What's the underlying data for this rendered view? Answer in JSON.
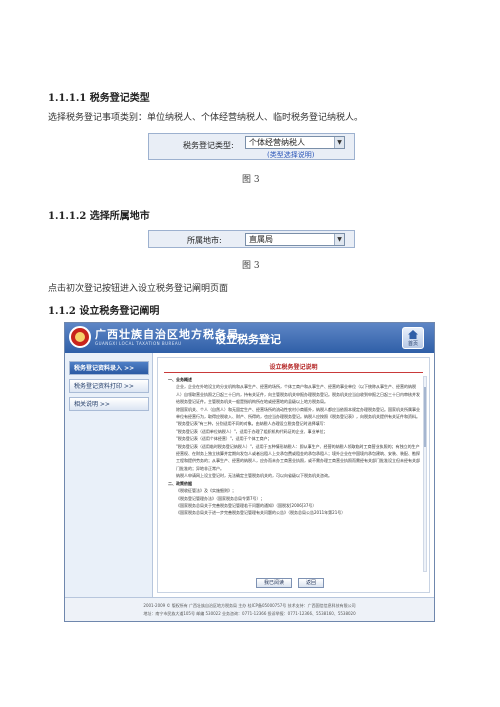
{
  "section_a": {
    "heading": "1.1.1.1 税务登记类型",
    "text": "选择税务登记事项类别：单位纳税人、个体经营纳税人、临时税务登记纳税人。",
    "form": {
      "label": "税务登记类型:",
      "value": "个体经营纳税人",
      "link": "(类型选择说明)"
    },
    "caption": "图 3"
  },
  "section_b": {
    "heading": "1.1.1.2 选择所属地市",
    "form": {
      "label": "所属地市:",
      "value": "直属局"
    },
    "caption": "图 3"
  },
  "instruction": "点击初次登记按钮进入设立税务登记阐明页面",
  "section_c": {
    "heading": "1.1.2 设立税务登记阐明"
  },
  "app": {
    "brand": "广西壮族自治区地方税务局",
    "brand_en": "GUANGXI LOCAL TAXATION BUREAU",
    "title": "设立税务登记",
    "home_label": "首页",
    "sidebar": [
      {
        "label": "税务登记资料录入 >>",
        "active": true
      },
      {
        "label": "税务登记资料打印 >>",
        "active": false
      },
      {
        "label": "相关说明 >>",
        "active": false
      }
    ],
    "doc": {
      "title": "设立税务登记说明",
      "lines": [
        {
          "t": "一、业务概述",
          "sec": true
        },
        {
          "t": "企业，企业在外地设立的分支机构和从事生产、经营的场所，个体工商户和从事生产、经营的事业单位（以下统称从事生产、经营的纳税人）自领取营业执照之日起三十日内，持有关证件，向主管税务机关申报办理税务登记。税务机关应当自收到申报之日起三十日内审核并发给税务登记证件。主管税务机关一般是指机构所在地或经营地的县级以上地方税务局。",
          "ind": true
        },
        {
          "t": "除国家机关、个人（自然人）和无固定生产、经营场所的流动性农村小商贩外，纳税人都应当依照本规定办理税务登记。国家机关所属事业单位有经营行为，取得应税收入、财产、所得的，也应当办理税务登记。纳税人应按照《税务登记表》，向税务机关提供有关证件和资料。",
          "ind": true
        },
        {
          "t": "\"税务登记表\"有三种，分别适用不同的对象。由纳税人办理设立税务登记时选择填写：",
          "ind": true
        },
        {
          "t": "\"税务登记表（适用单位纳税人）\"，适用于办理了组织机构代码证的企业、事业单位；",
          "ind": true
        },
        {
          "t": "\"税务登记表（适用个体经营）\"，适用于个体工商户；",
          "ind": true
        },
        {
          "t": "\"税务登记表（适用临时税务登记纳税人）\"，适用于五种情形纳税人：即从事生产、经营的纳税人领取临时工商营业执照的；有独立的生产经营权、在财务上独立核算并定期向发包人或者出租人上交承包费或租金的承包承租人；境外企业在中国境内承包建筑、安装、装配、勘探工程和提供劳务的；从事生产、经营的纳税人，应办而未办工商营业执照，或不需办理工商营业执照而需经有关部门批准设立但未经有关部门批准的；异地非正常户。",
          "ind": true
        },
        {
          "t": "纳税人申请网上设立登记时，无法确定主管税务机关的，可以向省级以下税务机关咨询。",
          "ind": true
        },
        {
          "t": "二、政策依据",
          "sec": true
        },
        {
          "t": "《税收征管法》及《实施细则》；",
          "ind": true
        },
        {
          "t": "《税务登记管理办法》（国家税务总局令第7号）；",
          "ind": true
        },
        {
          "t": "《国家税务总局关于完善税务登记管理若干问题的通知》（国税发[2006]37号）",
          "ind": true
        },
        {
          "t": "《国家税务总局关于进一步完善税务登记管理有关问题的公告》（税务总局公告2011年第21号）",
          "ind": true
        }
      ],
      "btn_next": "我已阅读",
      "btn_back": "返回"
    },
    "footer": [
      "2001-2009 © 版权所有 广西壮族自治区地方税务局 主办 桂ICP备05000757号 技术支持：广西国信信息科技有限公司",
      "地址：南宁市民族大道105号 邮编 530022 业务咨询：0771-12366 投诉举报：0771-12366、5538160、5538020"
    ]
  }
}
